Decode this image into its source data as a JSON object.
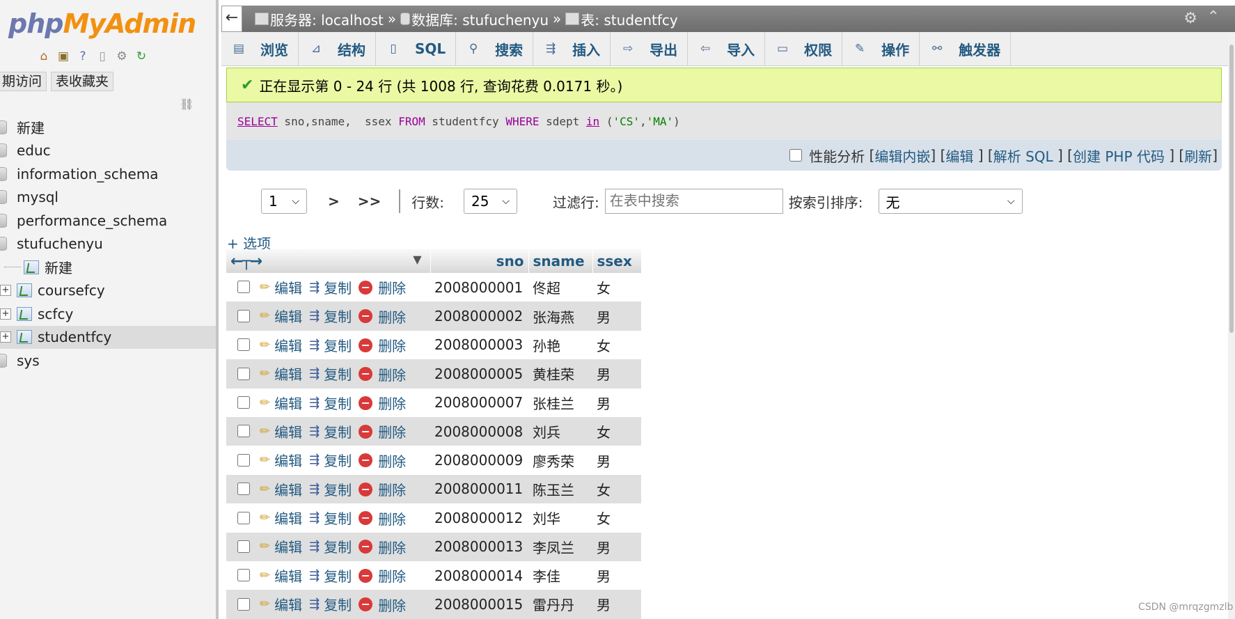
{
  "sidebar": {
    "logo_php": "php",
    "logo_myadmin": "MyAdmin",
    "tabs": [
      "期访问",
      "表收藏夹"
    ],
    "tree": {
      "new_db": "新建",
      "databases": [
        "educ",
        "information_schema",
        "mysql",
        "performance_schema",
        "stufuchenyu"
      ],
      "sub_new": "新建",
      "tables": [
        "coursefcy",
        "scfcy",
        "studentfcy"
      ],
      "last_db": "sys"
    }
  },
  "breadcrumb": {
    "server": "服务器: localhost",
    "database": "数据库: stufuchenyu",
    "table": "表: studentfcy",
    "sep": "»"
  },
  "tabs": [
    {
      "label": "浏览",
      "icon": "browse-icon"
    },
    {
      "label": "结构",
      "icon": "structure-icon"
    },
    {
      "label": "SQL",
      "icon": "sql-icon"
    },
    {
      "label": "搜索",
      "icon": "search-icon"
    },
    {
      "label": "插入",
      "icon": "insert-icon"
    },
    {
      "label": "导出",
      "icon": "export-icon"
    },
    {
      "label": "导入",
      "icon": "import-icon"
    },
    {
      "label": "权限",
      "icon": "privileges-icon"
    },
    {
      "label": "操作",
      "icon": "operations-icon"
    },
    {
      "label": "触发器",
      "icon": "triggers-icon"
    }
  ],
  "message": "正在显示第 0 - 24 行 (共 1008 行, 查询花费 0.0171 秒。)",
  "sql": {
    "select": "SELECT",
    "cols": " sno,sname,  ssex ",
    "from": "FROM",
    "table": " studentfcy ",
    "where": "WHERE",
    "field": " sdept ",
    "in": "in",
    "open": " (",
    "v1": "'CS'",
    "comma": ",",
    "v2": "'MA'",
    "close": ")"
  },
  "sql_tools": {
    "profiling": "性能分析",
    "edit_inline": "编辑内嵌",
    "edit": "编辑",
    "explain": "解析 SQL",
    "create_php": "创建 PHP 代码",
    "refresh": "刷新"
  },
  "nav": {
    "page": "1",
    "next": ">",
    "last": ">>",
    "rows_label": "行数:",
    "rows_value": "25",
    "filter_label": "过滤行:",
    "filter_placeholder": "在表中搜索",
    "sort_label": "按索引排序:",
    "sort_value": "无"
  },
  "options_link": "+ 选项",
  "table": {
    "columns": [
      "sno",
      "sname",
      "ssex"
    ],
    "actions": {
      "edit": "编辑",
      "copy": "复制",
      "delete": "删除"
    },
    "rows": [
      {
        "sno": "2008000001",
        "sname": "佟超",
        "ssex": "女"
      },
      {
        "sno": "2008000002",
        "sname": "张海燕",
        "ssex": "男"
      },
      {
        "sno": "2008000003",
        "sname": "孙艳",
        "ssex": "女"
      },
      {
        "sno": "2008000005",
        "sname": "黄桂荣",
        "ssex": "男"
      },
      {
        "sno": "2008000007",
        "sname": "张桂兰",
        "ssex": "男"
      },
      {
        "sno": "2008000008",
        "sname": "刘兵",
        "ssex": "女"
      },
      {
        "sno": "2008000009",
        "sname": "廖秀荣",
        "ssex": "男"
      },
      {
        "sno": "2008000011",
        "sname": "陈玉兰",
        "ssex": "女"
      },
      {
        "sno": "2008000012",
        "sname": "刘华",
        "ssex": "女"
      },
      {
        "sno": "2008000013",
        "sname": "李凤兰",
        "ssex": "男"
      },
      {
        "sno": "2008000014",
        "sname": "李佳",
        "ssex": "男"
      },
      {
        "sno": "2008000015",
        "sname": "雷丹丹",
        "ssex": "男"
      }
    ]
  },
  "watermark": "CSDN @mrqzgmzlb",
  "colors": {
    "link": "#235a81",
    "success_bg": "#ebf8a4",
    "logo_php": "#6c78af",
    "logo_myadmin": "#f29111"
  }
}
